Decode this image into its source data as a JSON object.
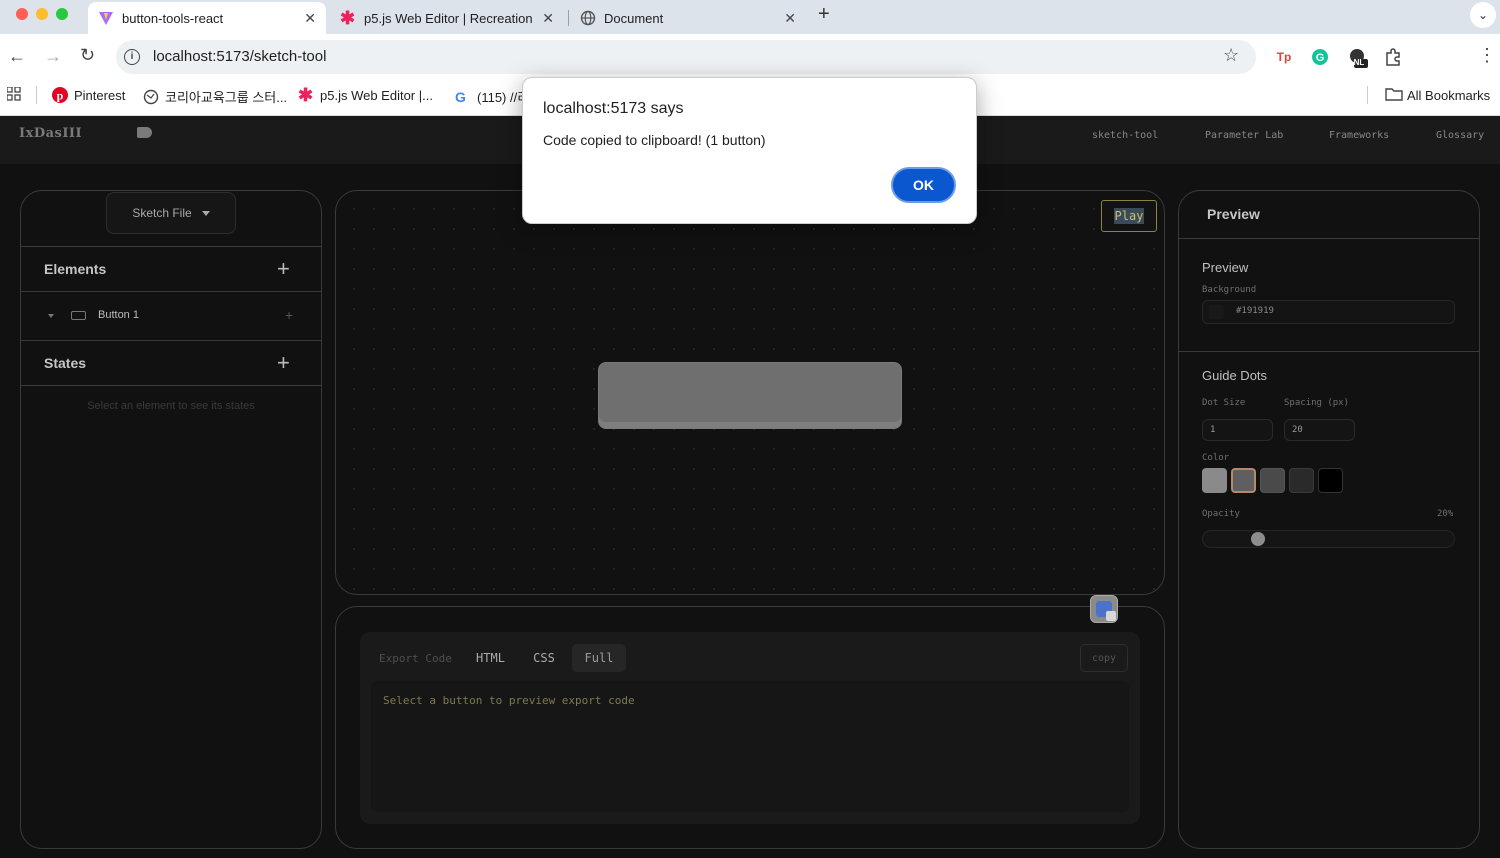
{
  "browser": {
    "tabs": [
      {
        "title": "button-tools-react",
        "active": true
      },
      {
        "title": "p5.js Web Editor | Recreation",
        "active": false
      },
      {
        "title": "Document",
        "active": false
      }
    ],
    "url": "localhost:5173/sketch-tool",
    "bookmarks": [
      {
        "label": "Pinterest",
        "icon": "pinterest-icon"
      },
      {
        "label": "코리아교육그룹 스터...",
        "icon": "globe-icon"
      },
      {
        "label": "p5.js Web Editor |...",
        "icon": "p5-asterisk-icon"
      },
      {
        "label": "(115) //리",
        "icon": "google-icon"
      }
    ],
    "all_bookmarks": "All Bookmarks",
    "extension_badge": "NL",
    "colors": {
      "tabbar": "#dde3ea",
      "accent": "#0b57d0"
    }
  },
  "app": {
    "logo": "IxDasIII",
    "nav": [
      "sketch-tool",
      "Parameter Lab",
      "Frameworks",
      "Glossary"
    ],
    "left": {
      "sketch_file": "Sketch File",
      "elements_title": "Elements",
      "element_items": [
        "Button 1"
      ],
      "states_title": "States",
      "states_hint": "Select an element to see its states"
    },
    "canvas": {
      "play_label": "Play"
    },
    "export": {
      "label": "Export Code",
      "tabs": [
        "HTML",
        "CSS",
        "Full"
      ],
      "active_tab": "Full",
      "copy_label": "copy",
      "placeholder": "Select a button to preview export code"
    },
    "right": {
      "title": "Preview",
      "preview_heading": "Preview",
      "background_label": "Background",
      "background_value": "#191919",
      "guide_dots_heading": "Guide Dots",
      "dot_size_label": "Dot Size",
      "spacing_label": "Spacing (px)",
      "dot_size_value": "1",
      "spacing_value": "20",
      "color_label": "Color",
      "color_swatches": [
        "#8a8a8a",
        "#5f5f5f",
        "#4a4a4a",
        "#2a2a2a",
        "#000000"
      ],
      "selected_swatch_index": 1,
      "opacity_label": "Opacity",
      "opacity_value": "20%",
      "opacity_fraction": 0.2
    }
  },
  "dialog": {
    "title": "localhost:5173 says",
    "message": "Code copied to clipboard! (1 button)",
    "ok_label": "OK"
  }
}
